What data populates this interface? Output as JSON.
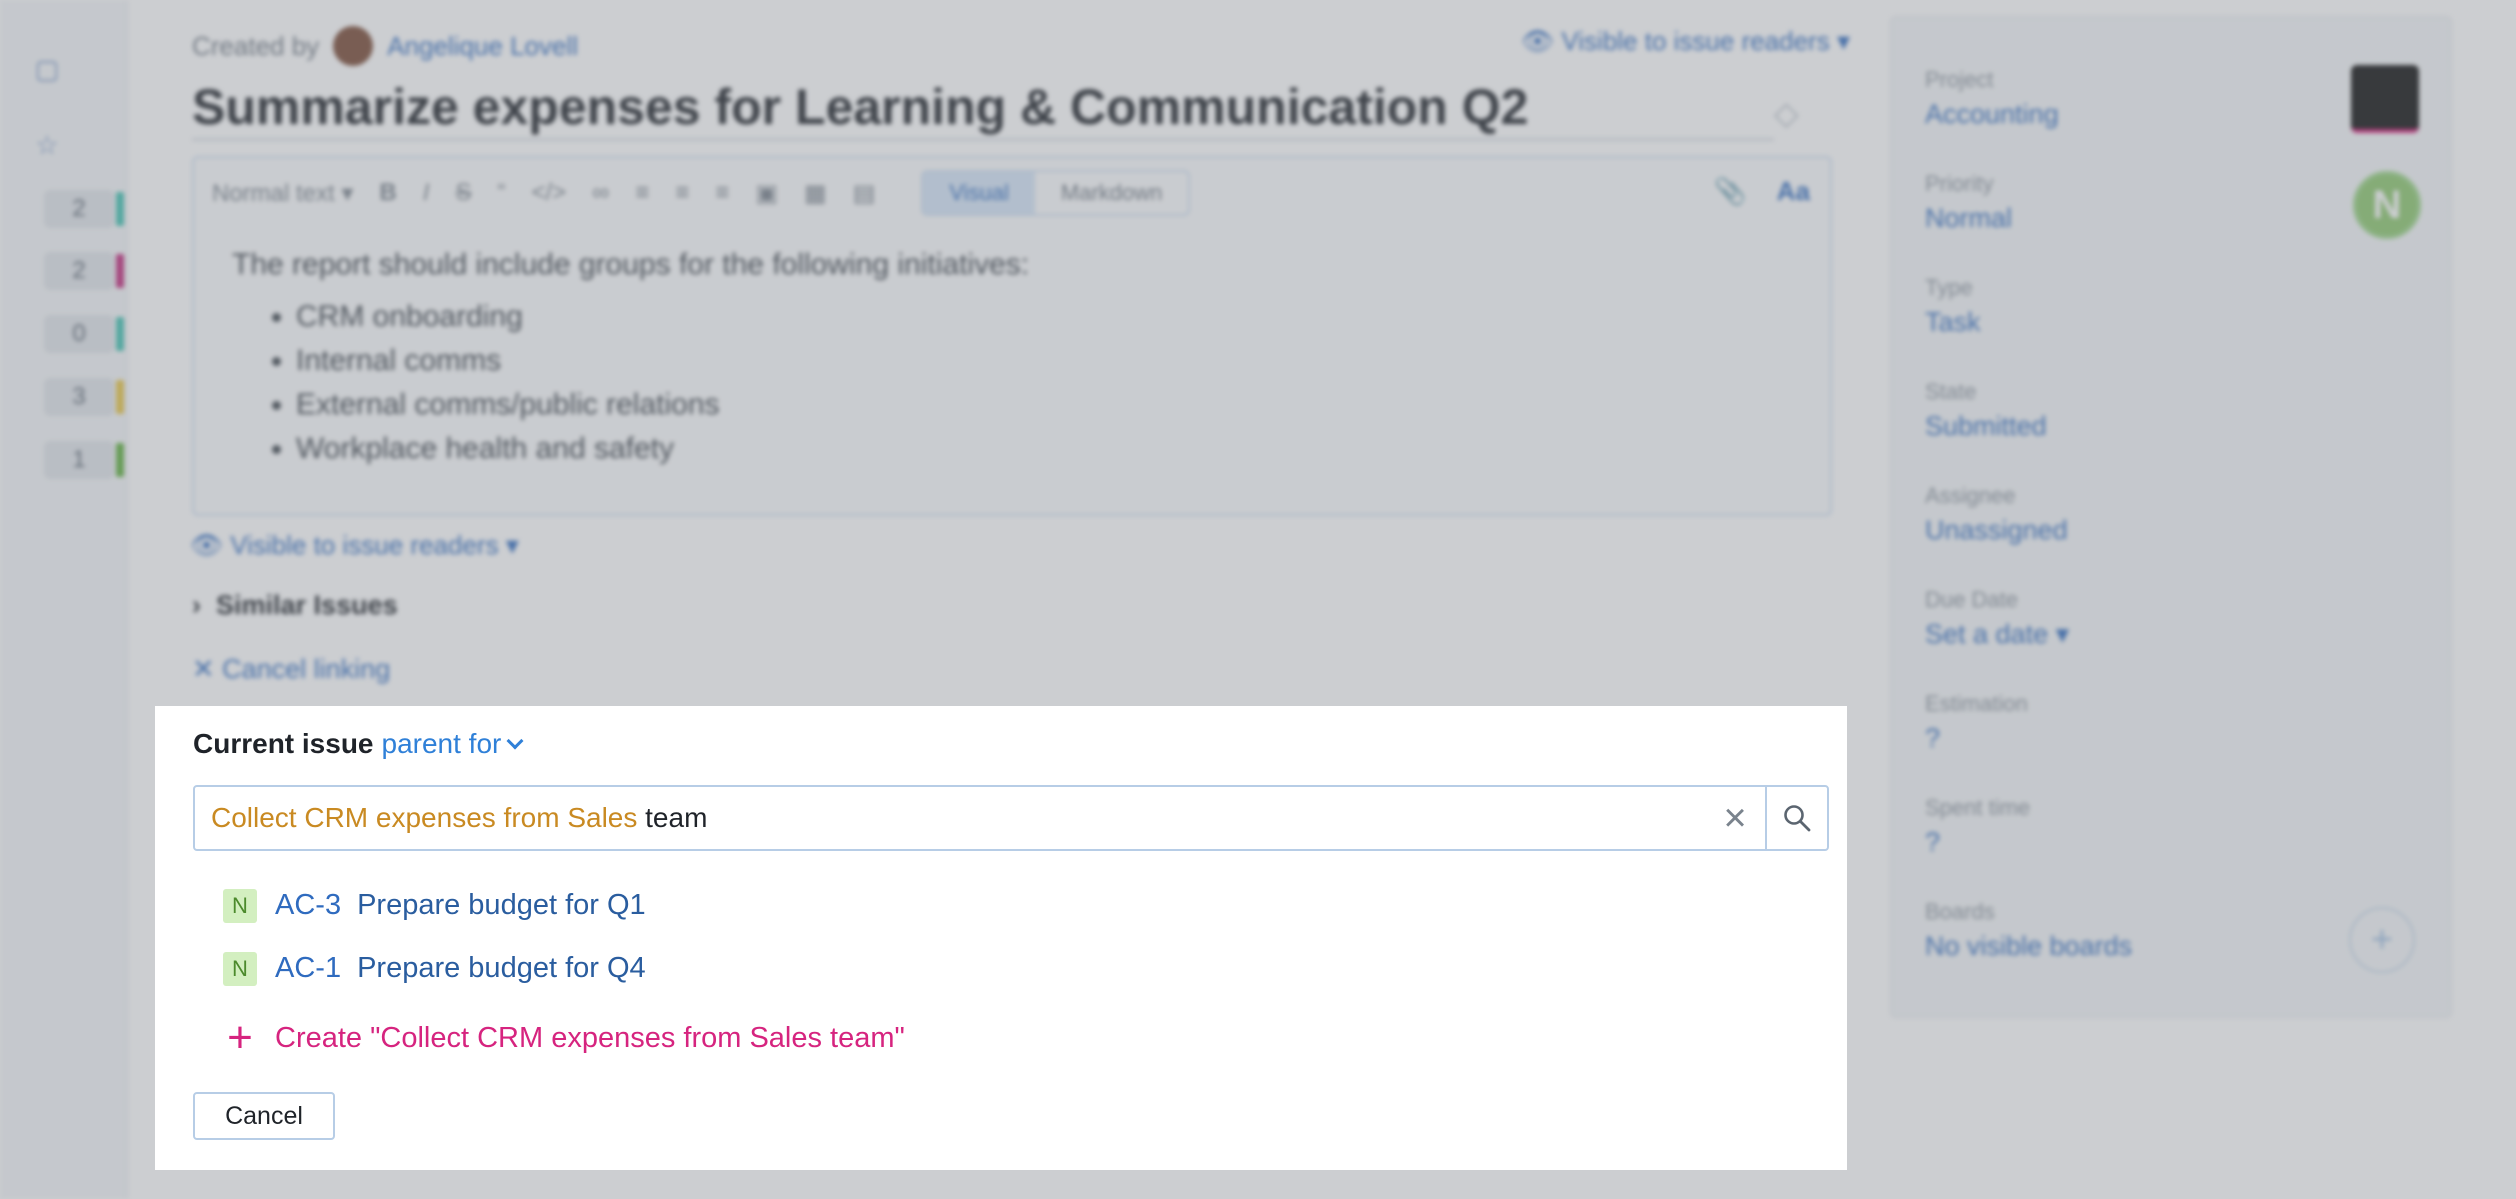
{
  "background": {
    "rail_counters": [
      "2",
      "2",
      "0",
      "3",
      "1"
    ],
    "rail_colors": [
      "#3fc1b0",
      "#c0267a",
      "#3fc1b0",
      "#e8c441",
      "#5cae3a"
    ],
    "created_by_label": "Created by",
    "author_name": "Angelique Lovell",
    "visibility_top": "Visible to issue readers",
    "summary": "Summarize expenses for Learning & Communication Q2",
    "toolbar": {
      "text_style": "Normal text",
      "visual_label": "Visual",
      "markdown_label": "Markdown"
    },
    "description_intro": "The report should include groups for the following initiatives:",
    "description_items": [
      "CRM onboarding",
      "Internal comms",
      "External comms/public relations",
      "Workplace health and safety"
    ],
    "visibility_comment": "Visible to issue readers",
    "similar_issues": "Similar Issues",
    "cancel_linking": "Cancel linking",
    "properties": [
      {
        "label": "Project",
        "value": "Accounting"
      },
      {
        "label": "Priority",
        "value": "Normal"
      },
      {
        "label": "Type",
        "value": "Task"
      },
      {
        "label": "State",
        "value": "Submitted"
      },
      {
        "label": "Assignee",
        "value": "Unassigned"
      },
      {
        "label": "Due Date",
        "value": "Set a date"
      },
      {
        "label": "Estimation",
        "value": "?"
      },
      {
        "label": "Spent time",
        "value": "?"
      },
      {
        "label": "Boards",
        "value": "No visible boards"
      }
    ],
    "priority_letter": "N"
  },
  "dialog": {
    "current_issue_label": "Current issue",
    "relation": "parent for",
    "search": {
      "highlight": "Collect CRM expenses from Sales",
      "rest": " team"
    },
    "results": [
      {
        "priority": "N",
        "id": "AC-3",
        "title": "Prepare budget for Q1"
      },
      {
        "priority": "N",
        "id": "AC-1",
        "title": "Prepare budget for Q4"
      }
    ],
    "create_label": "Create \"Collect CRM expenses from Sales team\"",
    "cancel_label": "Cancel"
  }
}
